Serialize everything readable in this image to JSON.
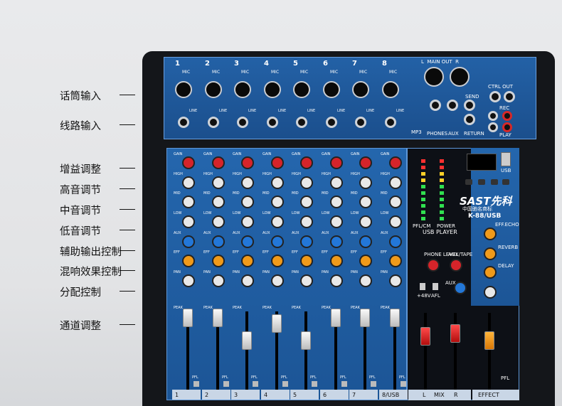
{
  "annotations": [
    "话筒输入",
    "线路输入",
    "增益调整",
    "高音调节",
    "中音调节",
    "低音调节",
    "辅助输出控制",
    "混响效果控制",
    "分配控制",
    "通道调整"
  ],
  "channels": [
    "1",
    "2",
    "3",
    "4",
    "5",
    "6",
    "7",
    "8"
  ],
  "channel_mic_label": "MIC",
  "line_label": "LINE",
  "knob_rows": [
    "GAIN",
    "HIGH",
    "MID",
    "LOW",
    "AUX",
    "EFF",
    "PAN"
  ],
  "peak_label": "PEAK",
  "pfl_label": "PFL",
  "bottom_channel_labels": [
    "1",
    "2",
    "3",
    "4",
    "5",
    "6",
    "7",
    "8/USB"
  ],
  "mix_labels": {
    "l": "L",
    "mix": "MIX",
    "r": "R"
  },
  "effect_label": "EFFECT",
  "brand": {
    "logo": "SAST先科",
    "sub": "中国驰名商标",
    "model": "K-88/USB"
  },
  "usb_player_label": "USB PLAYER",
  "usb_label": "USB",
  "main_out_labels": {
    "l": "L",
    "mainout": "MAIN OUT",
    "r": "R"
  },
  "aux_jacks": [
    "PHONES",
    "AUX",
    "RETURN"
  ],
  "send_label": "SEND",
  "ctrl_out_label": "CTRL OUT",
  "rec_label": "REC",
  "play_label": "PLAY",
  "phone_level_label": "PHONE LEVEL",
  "aux_tape_label": "AUX/TAPE",
  "aux_master_label": "AUX",
  "phantom_label": "+48V",
  "afl_label": "AFL",
  "power_label": "POWER",
  "pfl_level_label": "PFL/CM",
  "effect_labels": [
    "EFF.ECHO",
    "REVERB",
    "DELAY"
  ],
  "mp3_label": "MP3",
  "colors": {
    "panel_blue": "#1f5aa0",
    "knob_red": "#d6242a",
    "knob_blue": "#2377d8",
    "knob_orange": "#f09a1a",
    "knob_white": "#e8e8e8"
  }
}
